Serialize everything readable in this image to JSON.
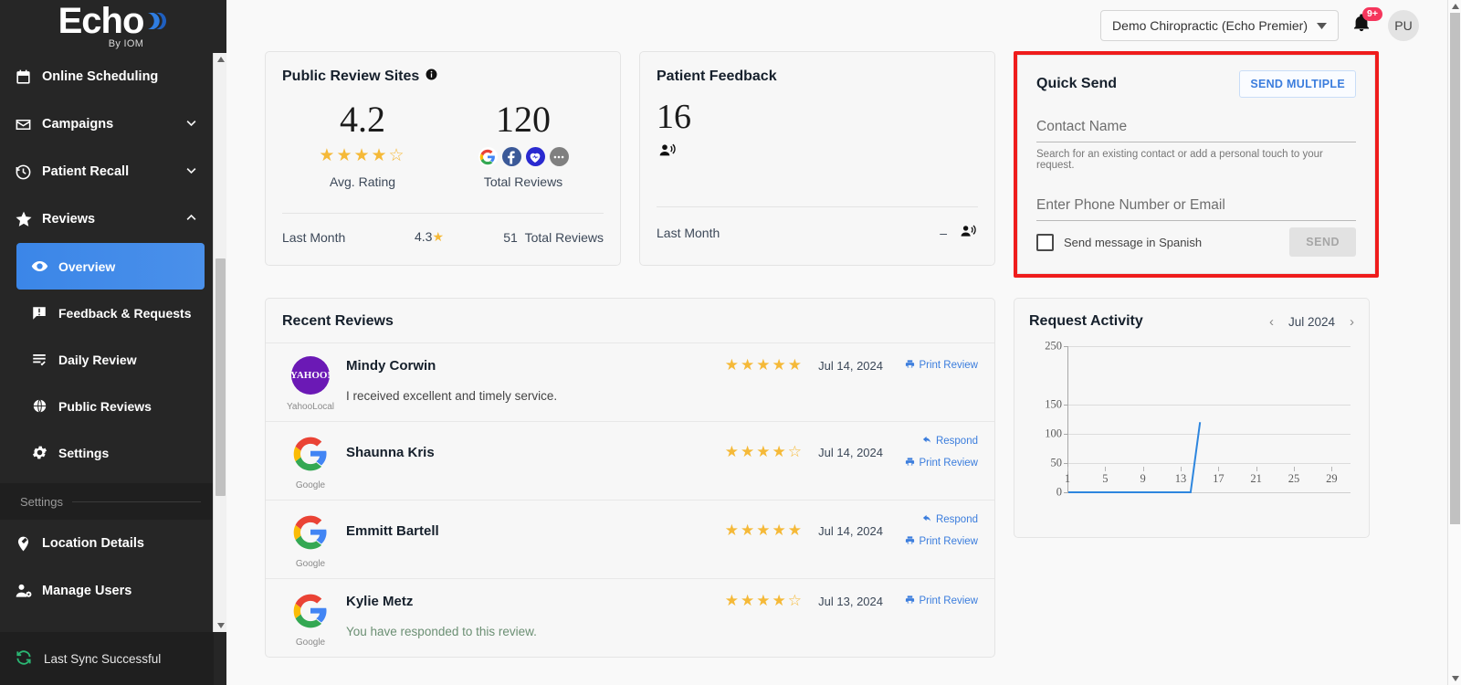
{
  "brand": {
    "name": "Echo",
    "tagline": "By IOM",
    "accent": "#2f7de1"
  },
  "sidebar": {
    "items": [
      {
        "label": "Online Scheduling",
        "icon": "calendar-icon",
        "chevron": ""
      },
      {
        "label": "Campaigns",
        "icon": "mail-icon",
        "chevron": "∨"
      },
      {
        "label": "Patient Recall",
        "icon": "history-icon",
        "chevron": "∨"
      },
      {
        "label": "Reviews",
        "icon": "star-icon",
        "chevron": "∧"
      }
    ],
    "sub_items": [
      {
        "label": "Overview",
        "icon": "eye-icon",
        "active": true
      },
      {
        "label": "Feedback & Requests",
        "icon": "feedback-icon",
        "active": false
      },
      {
        "label": "Daily Review",
        "icon": "list-check-icon",
        "active": false
      },
      {
        "label": "Public Reviews",
        "icon": "globe-icon",
        "active": false
      },
      {
        "label": "Settings",
        "icon": "gear-icon",
        "active": false
      }
    ],
    "section_label": "Settings",
    "settings_items": [
      {
        "label": "Location Details",
        "icon": "location-edit-icon"
      },
      {
        "label": "Manage Users",
        "icon": "manage-users-icon"
      }
    ],
    "sync_status": "Last Sync Successful",
    "sync_icon": "sync-icon"
  },
  "topbar": {
    "location": "Demo Chiropractic (Echo Premier)",
    "notification_count": "9+",
    "avatar_initials": "PU"
  },
  "public_review_sites": {
    "title": "Public Review Sites",
    "info_icon": "info-icon",
    "avg_rating": "4.2",
    "avg_rating_caption": "Avg. Rating",
    "stars_filled": 4,
    "total_reviews": "120",
    "total_reviews_caption": "Total Reviews",
    "sites": [
      "google-icon",
      "facebook-icon",
      "vitals-icon",
      "more-icon"
    ],
    "last_month_label": "Last Month",
    "last_month_rating": "4.3",
    "last_month_total": "51",
    "last_month_total_label": "Total Reviews"
  },
  "patient_feedback": {
    "title": "Patient Feedback",
    "count": "16",
    "count_icon": "person-speaking-icon",
    "last_month_label": "Last Month",
    "last_month_value": "–",
    "last_month_icon": "person-speaking-icon"
  },
  "quick_send": {
    "title": "Quick Send",
    "send_multiple_label": "SEND MULTIPLE",
    "contact_name_placeholder": "Contact Name",
    "contact_name_value": "",
    "help_text": "Search for an existing contact or add a personal touch to your request.",
    "phone_placeholder": "Enter Phone Number or Email",
    "phone_value": "",
    "spanish_label": "Send message in Spanish",
    "spanish_checked": false,
    "send_label": "SEND",
    "highlight_color": "#ef1c1c"
  },
  "recent_reviews": {
    "title": "Recent Reviews",
    "items": [
      {
        "name": "Mindy Corwin",
        "source": "YahooLocal",
        "source_icon": "yahoo-icon",
        "stars": 5,
        "date": "Jul 14, 2024",
        "actions": [
          {
            "label": "Print Review",
            "icon": "print-icon"
          }
        ],
        "text": "I received excellent and timely service.",
        "responded": false
      },
      {
        "name": "Shaunna Kris",
        "source": "Google",
        "source_icon": "google-icon",
        "stars": 4,
        "date": "Jul 14, 2024",
        "actions": [
          {
            "label": "Respond",
            "icon": "reply-icon"
          },
          {
            "label": "Print Review",
            "icon": "print-icon"
          }
        ],
        "text": "",
        "responded": false
      },
      {
        "name": "Emmitt Bartell",
        "source": "Google",
        "source_icon": "google-icon",
        "stars": 5,
        "date": "Jul 14, 2024",
        "actions": [
          {
            "label": "Respond",
            "icon": "reply-icon"
          },
          {
            "label": "Print Review",
            "icon": "print-icon"
          }
        ],
        "text": "",
        "responded": false
      },
      {
        "name": "Kylie Metz",
        "source": "Google",
        "source_icon": "google-icon",
        "stars": 4,
        "date": "Jul 13, 2024",
        "actions": [
          {
            "label": "Print Review",
            "icon": "print-icon"
          }
        ],
        "text": "You have responded to this review.",
        "responded": true
      }
    ]
  },
  "request_activity": {
    "title": "Request Activity",
    "period": "Jul 2024",
    "prev_icon": "chevron-left-icon",
    "next_icon": "chevron-right-icon"
  },
  "chart_data": {
    "type": "line",
    "title": "Request Activity",
    "xlabel": "",
    "ylabel": "",
    "xlim": [
      1,
      31
    ],
    "ylim": [
      0,
      250
    ],
    "yticks": [
      0,
      50,
      100,
      150,
      250
    ],
    "ytick_labels": [
      "0",
      "50",
      "100",
      "150",
      "250"
    ],
    "xticks": [
      1,
      5,
      9,
      13,
      17,
      21,
      25,
      29
    ],
    "xtick_labels": [
      "1",
      "5",
      "9",
      "13",
      "17",
      "21",
      "25",
      "29"
    ],
    "grid": true,
    "legend": "none",
    "line_color": "#2e86de",
    "series": [
      {
        "name": "Requests",
        "x": [
          1,
          2,
          3,
          4,
          5,
          6,
          7,
          8,
          9,
          10,
          11,
          12,
          13,
          14,
          15,
          16,
          17,
          18,
          19,
          20,
          21,
          22,
          23,
          24,
          25,
          26,
          27,
          28,
          29,
          30,
          31
        ],
        "values": [
          0,
          0,
          0,
          0,
          0,
          0,
          0,
          0,
          0,
          0,
          0,
          0,
          0,
          0,
          120,
          null,
          null,
          null,
          null,
          null,
          null,
          null,
          null,
          null,
          null,
          null,
          null,
          null,
          null,
          null,
          null
        ]
      }
    ]
  }
}
